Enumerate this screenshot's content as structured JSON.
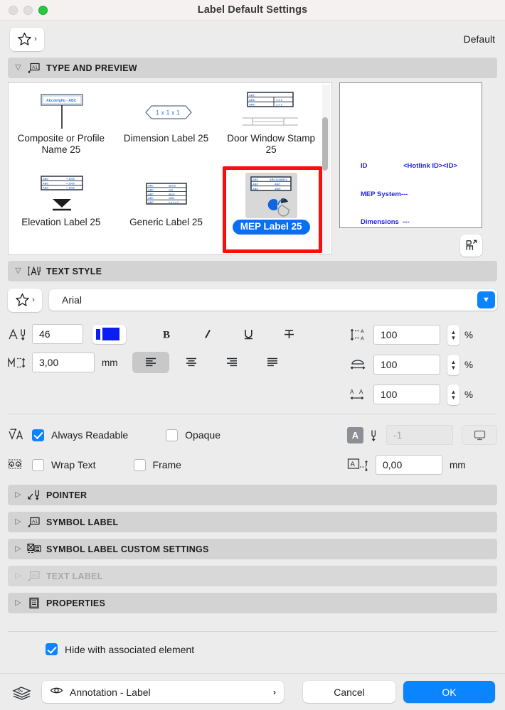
{
  "window": {
    "title": "Label Default Settings"
  },
  "favorites": {
    "icon": "star-icon",
    "chevron": "›",
    "default_label": "Default"
  },
  "sections": {
    "type_and_preview": {
      "title": "TYPE AND PREVIEW",
      "expanded": true
    },
    "text_style": {
      "title": "TEXT STYLE",
      "expanded": true
    },
    "pointer": {
      "title": "POINTER",
      "expanded": false
    },
    "symbol_label": {
      "title": "SYMBOL LABEL",
      "expanded": false
    },
    "symbol_label_custom": {
      "title": "SYMBOL LABEL CUSTOM SETTINGS",
      "expanded": false
    },
    "text_label": {
      "title": "TEXT LABEL",
      "expanded": false,
      "disabled": true
    },
    "properties": {
      "title": "PROPERTIES",
      "expanded": false
    }
  },
  "type_grid": {
    "items": [
      {
        "label": "Composite or Profile Name 25",
        "selected": false,
        "thumb": "composite-profile-thumb"
      },
      {
        "label": "Dimension Label 25",
        "selected": false,
        "thumb": "dimension-label-thumb"
      },
      {
        "label": "Door Window Stamp 25",
        "selected": false,
        "thumb": "door-window-stamp-thumb"
      },
      {
        "label": "Elevation Label 25",
        "selected": false,
        "thumb": "elevation-label-thumb"
      },
      {
        "label": "Generic Label 25",
        "selected": false,
        "thumb": "generic-label-thumb"
      },
      {
        "label": "MEP Label 25",
        "selected": true,
        "thumb": "mep-label-thumb"
      }
    ],
    "thumb_sample_text": "Abcdefghij - ABC",
    "dimension_sample_text": "1 x 1 x 1",
    "generic_rows": [
      [
        "ABC",
        "abcde"
      ],
      [
        "ABC",
        "123"
      ],
      [
        "ABC",
        "abcd"
      ],
      [
        "ABC",
        "1000"
      ],
      [
        "ABC",
        "1 x 1 x 1"
      ]
    ],
    "mep_rows": [
      [
        "ABC",
        "ABC123ABC1"
      ],
      [
        "ABC",
        "ABC"
      ],
      [
        "ABC",
        "1000"
      ]
    ],
    "door_rows": [
      [
        "ABC",
        ""
      ],
      [
        "ABC",
        "1 x 1"
      ],
      [
        "ABC",
        "1 x 1"
      ]
    ],
    "highlight_color": "#fc0d0d",
    "selection_color": "#0a6ff1"
  },
  "preview": {
    "lines": [
      {
        "key": "ID",
        "value": "<Hotlink ID><ID>"
      },
      {
        "key": "MEP System---",
        "value": ""
      },
      {
        "key": "Dimensions  ---",
        "value": ""
      }
    ],
    "text_color": "#2524e8",
    "button_icon": "chair-3d-icon"
  },
  "text_style": {
    "favorites_icon": "star-icon",
    "font": {
      "value": "Arial",
      "chevron_icon": "chevron-down-icon"
    },
    "pen": {
      "icon": "text-pen-icon",
      "value": "46",
      "swatch_color": "#0b1cf5"
    },
    "size": {
      "icon": "text-height-icon",
      "value": "3,00",
      "unit": "mm"
    },
    "style_buttons": [
      {
        "name": "bold",
        "glyph": "B",
        "active": false
      },
      {
        "name": "italic",
        "glyph": "I",
        "active": false
      },
      {
        "name": "underline",
        "glyph": "U",
        "active": false
      },
      {
        "name": "strikethrough",
        "glyph": "T",
        "active": false
      }
    ],
    "align_buttons": [
      {
        "name": "align-left",
        "active": true
      },
      {
        "name": "align-center",
        "active": false
      },
      {
        "name": "align-right",
        "active": false
      },
      {
        "name": "align-justify",
        "active": false
      }
    ],
    "spacing": [
      {
        "name": "line-spacing",
        "icon": "line-spacing-icon",
        "value": "100",
        "unit": "%"
      },
      {
        "name": "width-factor",
        "icon": "width-factor-icon",
        "value": "100",
        "unit": "%"
      },
      {
        "name": "character-spacing",
        "icon": "char-spacing-icon",
        "value": "100",
        "unit": "%"
      }
    ],
    "checkboxes": [
      {
        "name": "always-readable",
        "label": "Always Readable",
        "checked": true,
        "icon": "always-readable-icon"
      },
      {
        "name": "wrap-text",
        "label": "Wrap Text",
        "checked": false,
        "icon": "wrap-text-icon"
      },
      {
        "name": "opaque",
        "label": "Opaque",
        "checked": false
      },
      {
        "name": "frame",
        "label": "Frame",
        "checked": false
      }
    ],
    "frame_pen": {
      "value": "-1",
      "disabled": true,
      "icon": "frame-pen-icon",
      "display_icon": "monitor-icon"
    },
    "offset": {
      "icon": "text-offset-icon",
      "value": "0,00",
      "unit": "mm"
    }
  },
  "footer": {
    "hide_checkbox": {
      "label": "Hide with associated element",
      "checked": true
    },
    "layer_icon": "layers-icon",
    "layer": {
      "eye_icon": "eye-icon",
      "value": "Annotation - Label",
      "chevron": "›"
    },
    "cancel_label": "Cancel",
    "ok_label": "OK",
    "accent_color": "#0a84ff"
  }
}
